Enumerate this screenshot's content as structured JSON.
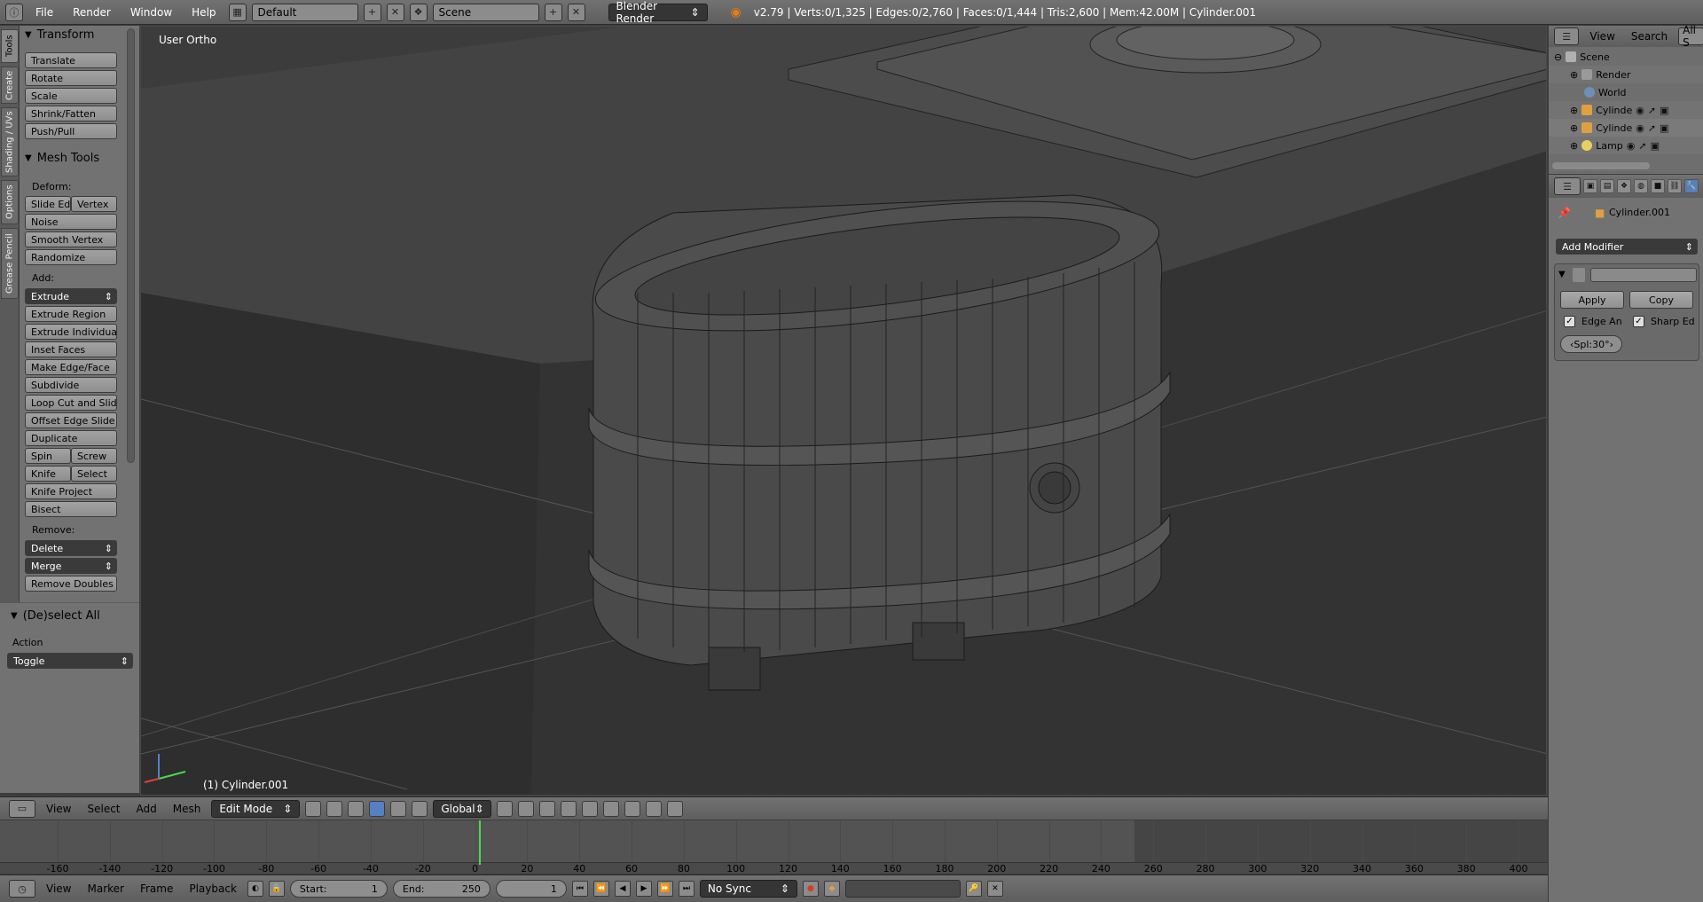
{
  "top": {
    "menus": [
      "File",
      "Render",
      "Window",
      "Help"
    ],
    "layout": "Default",
    "scene": "Scene",
    "engine": "Blender Render",
    "stats": "v2.79 | Verts:0/1,325 | Edges:0/2,760 | Faces:0/1,444 | Tris:2,600 | Mem:42.00M | Cylinder.001"
  },
  "tabs": [
    "Tools",
    "Create",
    "Shading / UVs",
    "Options",
    "Grease Pencil"
  ],
  "transform": {
    "title": "Transform",
    "buttons": [
      "Translate",
      "Rotate",
      "Scale",
      "Shrink/Fatten",
      "Push/Pull"
    ]
  },
  "mesh_tools": {
    "title": "Mesh Tools",
    "deform_label": "Deform:",
    "slide_edge": "Slide Ed",
    "vertex": "Vertex",
    "deform": [
      "Noise",
      "Smooth Vertex",
      "Randomize"
    ],
    "add_label": "Add:",
    "extrude": "Extrude",
    "add": [
      "Extrude Region",
      "Extrude Individual",
      "Inset Faces",
      "Make Edge/Face",
      "Subdivide",
      "Loop Cut and Slide",
      "Offset Edge Slide",
      "Duplicate"
    ],
    "spin": "Spin",
    "screw": "Screw",
    "knife": "Knife",
    "select": "Select",
    "knife_project": "Knife Project",
    "bisect": "Bisect",
    "remove_label": "Remove:",
    "delete": "Delete",
    "merge": "Merge",
    "remove_doubles": "Remove Doubles"
  },
  "redo": {
    "title": "(De)select All",
    "action_label": "Action",
    "action_value": "Toggle"
  },
  "viewport": {
    "view_label": "User Ortho",
    "object_label": "(1) Cylinder.001"
  },
  "outliner": {
    "menus": [
      "View",
      "Search"
    ],
    "filter": "All S",
    "items": [
      "Scene",
      "Render",
      "World",
      "Cylinde",
      "Cylinde",
      "Lamp"
    ]
  },
  "properties": {
    "object_name": "Cylinder.001",
    "add_modifier": "Add Modifier",
    "apply": "Apply",
    "copy": "Copy",
    "edge_angle": "Edge An",
    "sharp_edges": "Sharp Ed",
    "split_angle": "Spl:30°"
  },
  "header3d": {
    "menus": [
      "View",
      "Select",
      "Add",
      "Mesh"
    ],
    "mode": "Edit Mode",
    "orientation": "Global"
  },
  "timeline": {
    "ticks": [
      "-160",
      "-140",
      "-120",
      "-100",
      "-80",
      "-60",
      "-40",
      "-20",
      "0",
      "20",
      "40",
      "60",
      "80",
      "100",
      "120",
      "140",
      "160",
      "180",
      "200",
      "220",
      "240",
      "260",
      "280",
      "300",
      "320",
      "340",
      "360",
      "380",
      "400"
    ],
    "menus": [
      "View",
      "Marker",
      "Frame",
      "Playback"
    ],
    "start_label": "Start:",
    "start_value": "1",
    "end_label": "End:",
    "end_value": "250",
    "current": "1",
    "sync": "No Sync"
  },
  "colors": {
    "cursor": "#4ad94a",
    "active_blue": "#5680c2"
  }
}
